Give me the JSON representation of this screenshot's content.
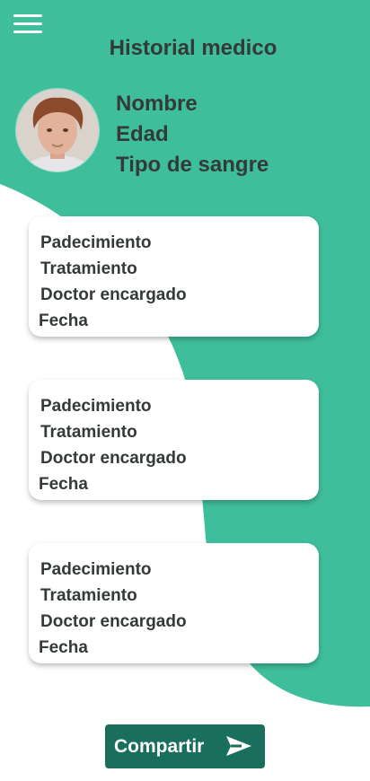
{
  "header": {
    "title": "Historial medico"
  },
  "profile": {
    "name": "Nombre",
    "age": "Edad",
    "blood_type": "Tipo de sangre"
  },
  "records": [
    {
      "condition": "Padecimiento",
      "treatment": "Tratamiento",
      "doctor": "Doctor encargado",
      "date": "Fecha"
    },
    {
      "condition": "Padecimiento",
      "treatment": "Tratamiento",
      "doctor": "Doctor encargado",
      "date": "Fecha"
    },
    {
      "condition": "Padecimiento",
      "treatment": "Tratamiento",
      "doctor": "Doctor encargado",
      "date": "Fecha"
    }
  ],
  "actions": {
    "share_label": "Compartir"
  },
  "icons": {
    "menu": "hamburger-menu-icon",
    "share": "send-icon"
  },
  "colors": {
    "accent": "#3fbe9c",
    "button": "#1a6e5e",
    "text": "#333a38"
  }
}
